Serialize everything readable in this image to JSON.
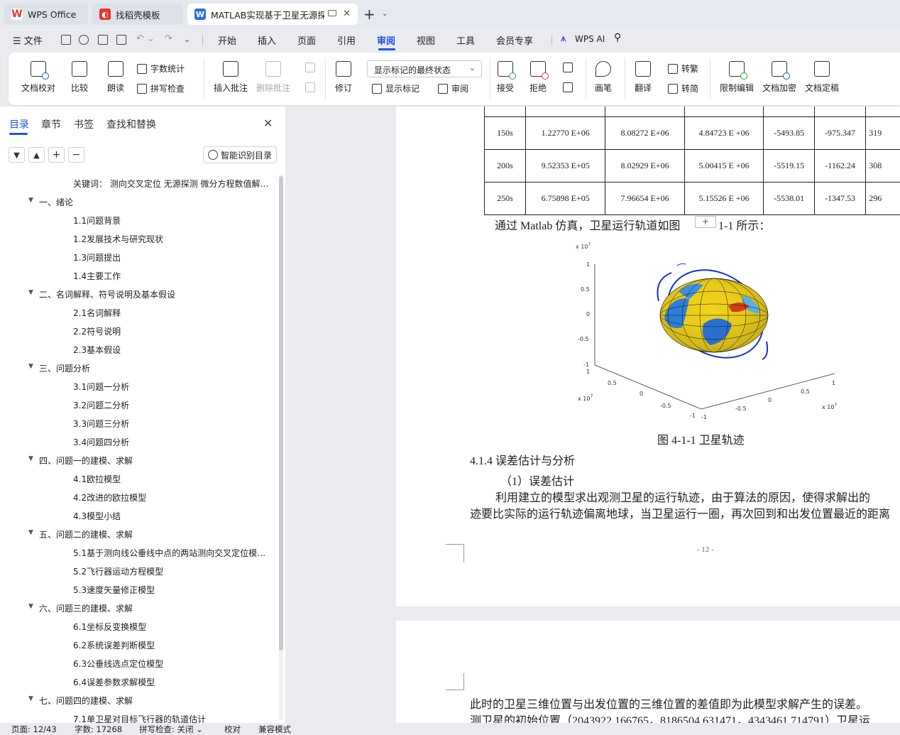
{
  "tabs": [
    {
      "label": "WPS Office",
      "logo": "W",
      "logo_color": "#e5352d"
    },
    {
      "label": "找稻壳模板",
      "logo": "◐",
      "logo_color": "#e5352d"
    },
    {
      "label": "MATLAB实现基于卫星无源探",
      "logo": "W",
      "logo_color": "#2f6de1"
    }
  ],
  "menu": {
    "file": "文件",
    "items": [
      "开始",
      "插入",
      "页面",
      "引用",
      "审阅",
      "视图",
      "工具",
      "会员专享"
    ],
    "selected": "审阅",
    "wps_ai": "WPS AI"
  },
  "ribbon": {
    "doc_check": "文档校对",
    "compare": "比较",
    "read_aloud": "朗读",
    "word_count": "字数统计",
    "spell_check": "拼写检查",
    "insert_comment": "插入批注",
    "delete_comment": "删除批注",
    "track_changes": "修订",
    "markup_state": "显示标记的最终状态",
    "show_markup": "显示标记",
    "review": "审阅",
    "accept": "接受",
    "reject": "拒绝",
    "pen": "画笔",
    "translate": "翻译",
    "to_traditional": "转繁",
    "to_simplified": "转简",
    "restrict_edit": "限制编辑",
    "doc_encrypt": "文档加密",
    "doc_finalize": "文档定稿"
  },
  "nav": {
    "tabs": [
      "目录",
      "章节",
      "书签",
      "查找和替换"
    ],
    "smart_toc": "智能识别目录",
    "toc": [
      {
        "label": "关键词： 测向交叉定位 无源探测 微分方程数值解…",
        "level": 2,
        "arrow": false
      },
      {
        "label": "一、绪论",
        "level": 1,
        "arrow": true
      },
      {
        "label": "1.1问题背景",
        "level": 2,
        "arrow": false
      },
      {
        "label": "1.2发展技术与研究现状",
        "level": 2,
        "arrow": false
      },
      {
        "label": "1.3问题提出",
        "level": 2,
        "arrow": false
      },
      {
        "label": "1.4主要工作",
        "level": 2,
        "arrow": false
      },
      {
        "label": "二、名词解释、符号说明及基本假设",
        "level": 1,
        "arrow": true
      },
      {
        "label": "2.1名词解释",
        "level": 2,
        "arrow": false
      },
      {
        "label": "2.2符号说明",
        "level": 2,
        "arrow": false
      },
      {
        "label": "2.3基本假设",
        "level": 2,
        "arrow": false
      },
      {
        "label": "三、问题分析",
        "level": 1,
        "arrow": true
      },
      {
        "label": "3.1问题一分析",
        "level": 2,
        "arrow": false
      },
      {
        "label": "3.2问题二分析",
        "level": 2,
        "arrow": false
      },
      {
        "label": "3.3问题三分析",
        "level": 2,
        "arrow": false
      },
      {
        "label": "3.4问题四分析",
        "level": 2,
        "arrow": false
      },
      {
        "label": "四、问题一的建模、求解",
        "level": 1,
        "arrow": true
      },
      {
        "label": "4.1欧拉模型",
        "level": 2,
        "arrow": false
      },
      {
        "label": "4.2改进的欧拉模型",
        "level": 2,
        "arrow": false
      },
      {
        "label": "4.3模型小结",
        "level": 2,
        "arrow": false
      },
      {
        "label": "五、问题二的建模、求解",
        "level": 1,
        "arrow": true
      },
      {
        "label": "5.1基于测向线公垂线中点的两站测向交叉定位模…",
        "level": 2,
        "arrow": false
      },
      {
        "label": "5.2飞行器运动方程模型",
        "level": 2,
        "arrow": false
      },
      {
        "label": "5.3速度矢量修正模型",
        "level": 2,
        "arrow": false
      },
      {
        "label": "六、问题三的建模、求解",
        "level": 1,
        "arrow": true
      },
      {
        "label": "6.1坐标反变换模型",
        "level": 2,
        "arrow": false
      },
      {
        "label": "6.2系统误差判断模型",
        "level": 2,
        "arrow": false
      },
      {
        "label": "6.3公垂线选点定位模型",
        "level": 2,
        "arrow": false
      },
      {
        "label": "6.4误差参数求解模型",
        "level": 2,
        "arrow": false
      },
      {
        "label": "七、问题四的建模、求解",
        "level": 1,
        "arrow": true
      },
      {
        "label": "7.1单卫星对目标飞行器的轨道估计",
        "level": 2,
        "arrow": false
      }
    ]
  },
  "document": {
    "table_rows": [
      [
        "150s",
        "1.22770 E+06",
        "8.08272 E+06",
        "4.84723 E +06",
        "-5493.85",
        "-975.347",
        "319"
      ],
      [
        "200s",
        "9.52353 E+05",
        "8.02929 E+06",
        "5.00415 E +06",
        "-5519.15",
        "-1162.24",
        "308"
      ],
      [
        "250s",
        "6.75898 E+05",
        "7.96654 E+06",
        "5.15526 E +06",
        "-5538.01",
        "-1347.53",
        "296"
      ]
    ],
    "sim_text_1": "通过 Matlab 仿真，卫星运行轨道如图",
    "sim_text_2": "1-1 所示：",
    "plus_label": "+",
    "figure": {
      "exp_label": "x 10",
      "exp_power": "7",
      "z_ticks": [
        "1",
        "0.5",
        "0",
        "-0.5",
        "-1"
      ],
      "x_ticks": [
        "1",
        "0.5",
        "0",
        "-0.5",
        "-1"
      ],
      "y_ticks": [
        "-1",
        "-0.5",
        "0",
        "0.5",
        "1"
      ],
      "caption": "图 4-1-1  卫星轨迹"
    },
    "section_heading": "4.1.4 误差估计与分析",
    "sub_heading": "（1）误差估计",
    "para_line1": "利用建立的模型求出观测卫星的运行轨迹，由于算法的原因，使得求解出的",
    "para_line2": "迹要比实际的运行轨迹偏离地球，当卫星运行一圈，再次回到和出发位置最近的距离",
    "page_number": "- 12 -",
    "page2_line1": "此时的卫星三维位置与出发位置的三维位置的差值即为此模型求解产生的误差。",
    "page2_line2": "测卫星的初始位置（2043922.166765，8186504.631471，4343461.714791）卫星运"
  },
  "status": {
    "page": "页面: 12/43",
    "words": "字数: 17268",
    "spell": "拼写检查: 关闭",
    "proof": "校对",
    "compat": "兼容模式"
  }
}
